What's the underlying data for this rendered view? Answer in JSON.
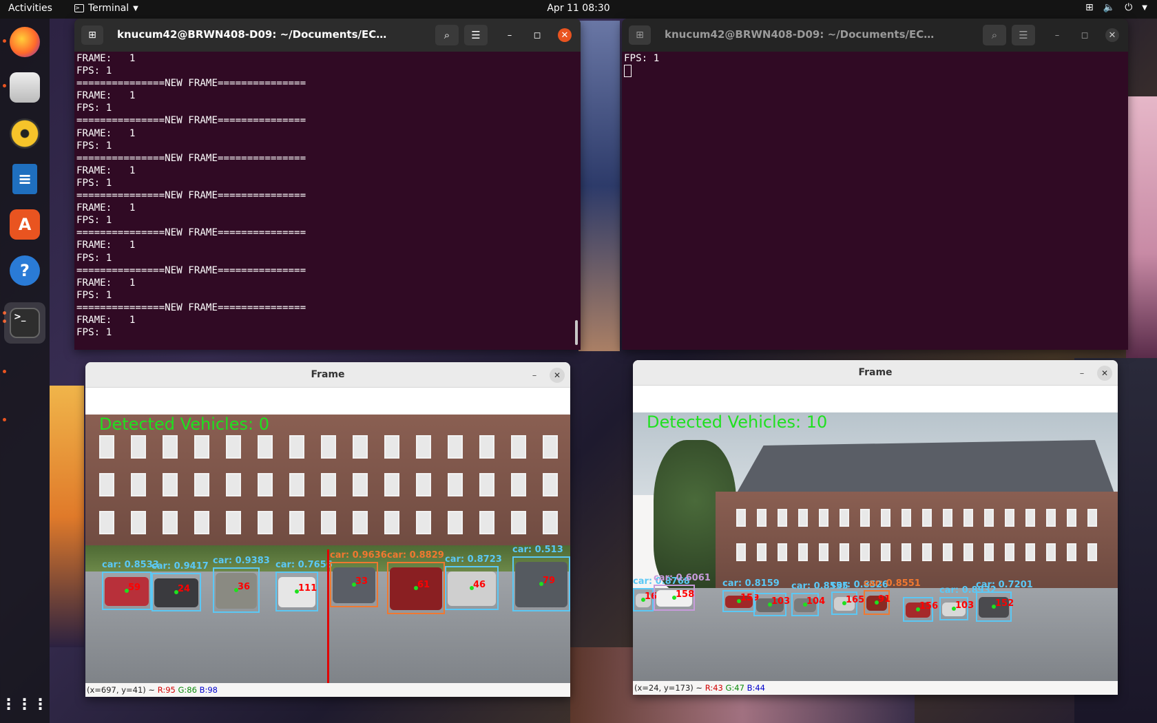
{
  "topbar": {
    "activities": "Activities",
    "app_menu": "Terminal",
    "clock": "Apr 11  08:30",
    "tray_icons": [
      "network-icon",
      "volume-icon",
      "power-icon"
    ]
  },
  "dock": {
    "items": [
      "firefox-icon",
      "files-icon",
      "rhythmbox-icon",
      "writer-icon",
      "app-center-icon",
      "help-icon",
      "terminal-icon"
    ],
    "show_apps": "show-applications-icon"
  },
  "terminal_left": {
    "title": "knucum42@BRWN408-D09: ~/Documents/ECE-Capstone-Tea...",
    "lines": [
      "FRAME:   1",
      "FPS: 1",
      "===============NEW FRAME===============",
      "FRAME:   1",
      "FPS: 1",
      "===============NEW FRAME===============",
      "FRAME:   1",
      "FPS: 1",
      "===============NEW FRAME===============",
      "FRAME:   1",
      "FPS: 1",
      "===============NEW FRAME===============",
      "FRAME:   1",
      "FPS: 1",
      "===============NEW FRAME===============",
      "FRAME:   1",
      "FPS: 1",
      "===============NEW FRAME===============",
      "FRAME:   1",
      "FPS: 1",
      "===============NEW FRAME===============",
      "FRAME:   1",
      "FPS: 1"
    ]
  },
  "terminal_right": {
    "title": "knucum42@BRWN408-D09: ~/Documents/ECE-Capstone-Tea...",
    "lines": [
      "FPS: 1"
    ]
  },
  "frame_left": {
    "title": "Frame",
    "detected": "Detected Vehicles: 0",
    "status_prefix": "(x=697, y=41) ~",
    "status_r": "R:95",
    "status_g": "G:86",
    "status_b": "B:98",
    "labels": [
      "car: 0.8533",
      "car: 0.9417",
      "car: 0.9383",
      "car: 0.7656",
      "car: 0.9636",
      "car: 0.8829",
      "car: 0.8723",
      "car: 0.513"
    ],
    "ids": [
      "59",
      "24",
      "36",
      "111",
      "33",
      "61",
      "46",
      "79"
    ],
    "colors": {
      "car": "#5bc8f5",
      "truck": "#f07830",
      "counter_line": "#e00000"
    }
  },
  "frame_right": {
    "title": "Frame",
    "detected": "Detected Vehicles: 10",
    "status_prefix": "(x=24, y=173) ~",
    "status_r": "R:43",
    "status_g": "G:47",
    "status_b": "B:44",
    "labels": [
      "car: 0.8768",
      "car: 0.6061",
      "car: 0.8159",
      "car: 0.8555",
      "car: 0.8526",
      "car: 0.8551",
      "car: 0.8932",
      "car: 0.7201"
    ],
    "ids": [
      "161",
      "158",
      "159",
      "103",
      "104",
      "165",
      "91",
      "156",
      "103",
      "152"
    ],
    "colors": {
      "car": "#5bc8f5",
      "truck": "#f07830",
      "bus": "#c89bdc"
    }
  }
}
